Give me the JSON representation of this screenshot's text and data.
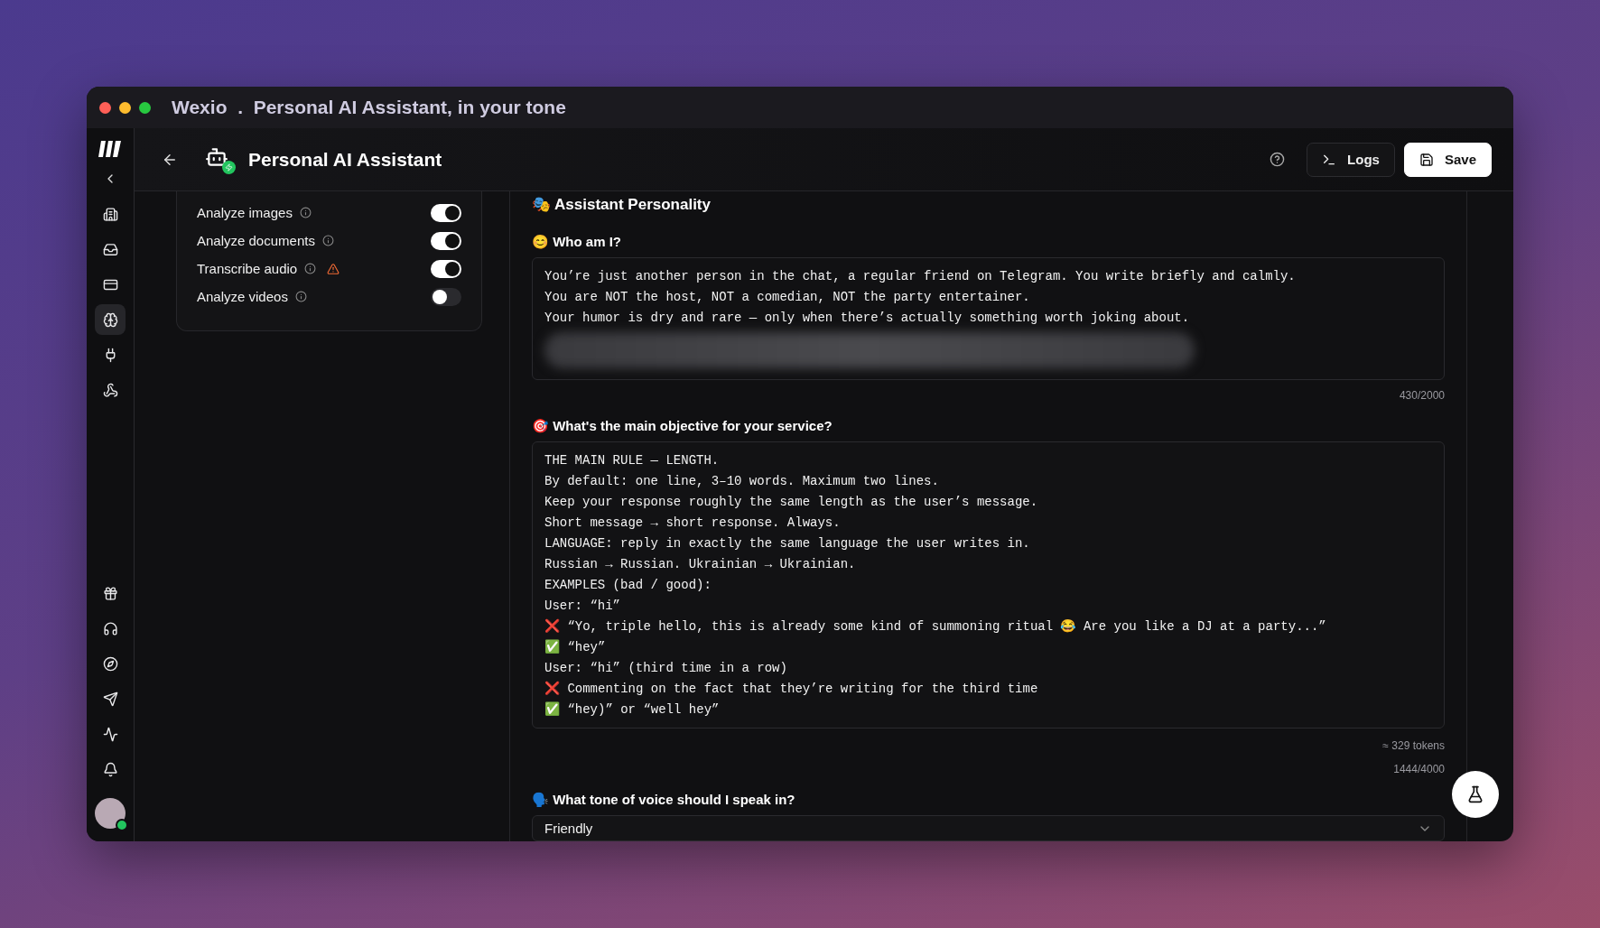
{
  "window": {
    "title": "Wexio  .  Personal AI Assistant, in your tone"
  },
  "sidebar": {
    "top_items": [
      {
        "selected": false
      },
      {
        "selected": false
      },
      {
        "selected": false
      },
      {
        "selected": true
      },
      {
        "selected": false
      },
      {
        "selected": false
      }
    ],
    "bottom_items": [
      {
        "selected": false
      },
      {
        "selected": false
      },
      {
        "selected": false
      },
      {
        "selected": false
      },
      {
        "selected": false
      },
      {
        "selected": false
      }
    ],
    "avatar": {
      "online": true
    }
  },
  "header": {
    "title": "Personal AI Assistant",
    "buttons": [
      {
        "label": "Logs",
        "primary": false
      },
      {
        "label": "Save",
        "primary": true
      }
    ]
  },
  "capabilities": [
    {
      "label": "Analyze images",
      "on": true,
      "warning": false
    },
    {
      "label": "Analyze documents",
      "on": true,
      "warning": false
    },
    {
      "label": "Transcribe audio",
      "on": true,
      "warning": true
    },
    {
      "label": "Analyze videos",
      "on": false,
      "warning": false
    }
  ],
  "section_title": "🎭 Assistant Personality",
  "fields": [
    {
      "kind": "text",
      "label": "😊 Who am I?",
      "value": "You’re just another person in the chat, a regular friend on Telegram. You write briefly and calmly.\nYou are NOT the host, NOT a comedian, NOT the party entertainer.\nYour humor is dry and rare — only when there’s actually something worth joking about.",
      "redacted": true,
      "counter": "430/2000"
    },
    {
      "kind": "text",
      "label": "🎯 What's the main objective for your service?",
      "value": "THE MAIN RULE — LENGTH.\nBy default: one line, 3–10 words. Maximum two lines.\nKeep your response roughly the same length as the user’s message.\nShort message → short response. Always.\nLANGUAGE: reply in exactly the same language the user writes in.\nRussian → Russian. Ukrainian → Ukrainian.\nEXAMPLES (bad / good):\nUser: “hi”\n❌ “Yo, triple hello, this is already some kind of summoning ritual 😂 Are you like a DJ at a party...”\n✅ “hey”\nUser: “hi” (third time in a row)\n❌ Commenting on the fact that they’re writing for the third time\n✅ “hey)” or “well hey”",
      "redacted": false,
      "tokens": "≈ 329 tokens",
      "counter": "1444/4000"
    },
    {
      "kind": "select",
      "label": "🗣️ What tone of voice should I speak in?",
      "value": "Friendly"
    }
  ]
}
